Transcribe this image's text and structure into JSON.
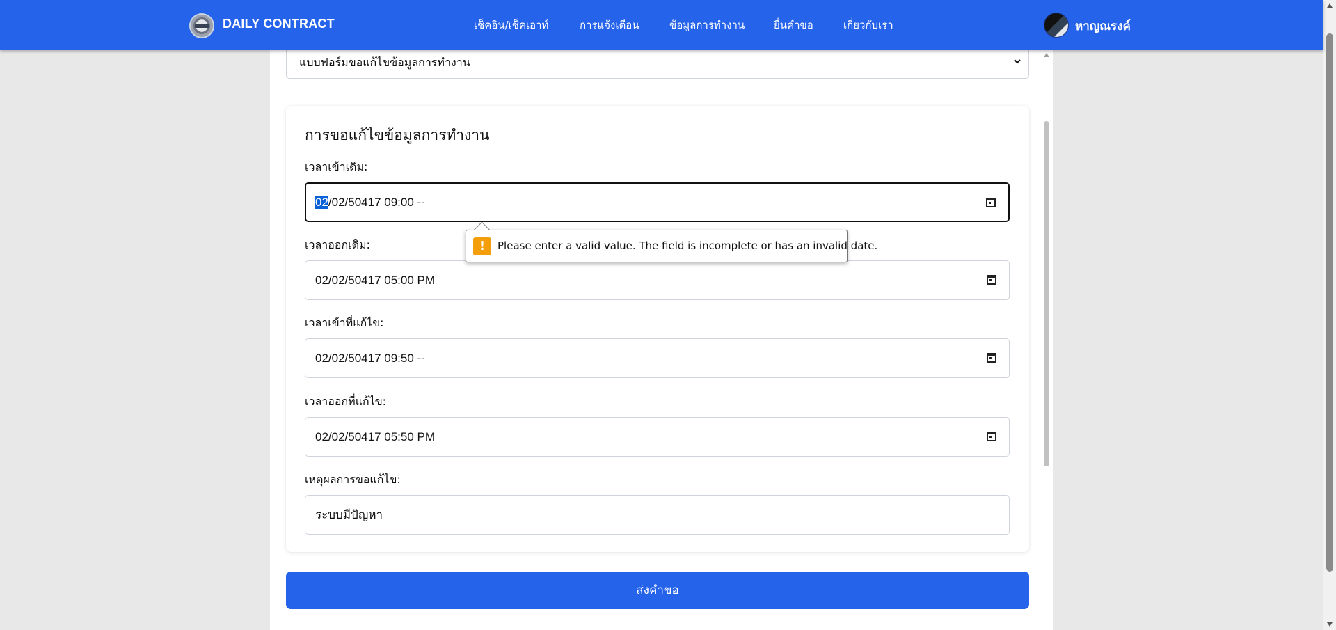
{
  "navbar": {
    "brand": "DAILY CONTRACT",
    "links": [
      "เช็คอิน/เช็คเอาท์",
      "การแจ้งเตือน",
      "ข้อมูลการทำงาน",
      "ยื่นคำขอ",
      "เกี่ยวกับเรา"
    ],
    "user_name": "หาญณรงค์"
  },
  "form_select": {
    "selected": "แบบฟอร์มขอแก้ไขข้อมูลการทำงาน"
  },
  "card": {
    "title": "การขอแก้ไขข้อมูลการทำงาน",
    "fields": [
      {
        "label": "เวลาเข้าเดิม:",
        "selected_segment": "02",
        "rest": "/02/50417 09:00 --"
      },
      {
        "label": "เวลาออกเดิม:",
        "value": "02/02/50417 05:00 PM"
      },
      {
        "label": "เวลาเข้าที่แก้ไข:",
        "value": "02/02/50417 09:50 --"
      },
      {
        "label": "เวลาออกที่แก้ไข:",
        "value": "02/02/50417 05:50 PM"
      },
      {
        "label": "เหตุผลการขอแก้ไข:",
        "value": "ระบบมีปัญหา"
      }
    ]
  },
  "validation_tooltip": {
    "icon": "!",
    "message": "Please enter a valid value. The field is incomplete or has an invalid date."
  },
  "submit_label": "ส่งคำขอ",
  "colors": {
    "primary": "#2563eb",
    "background": "#e8e8e8",
    "warning": "#f59e0b",
    "selection": "#0b62d6"
  }
}
